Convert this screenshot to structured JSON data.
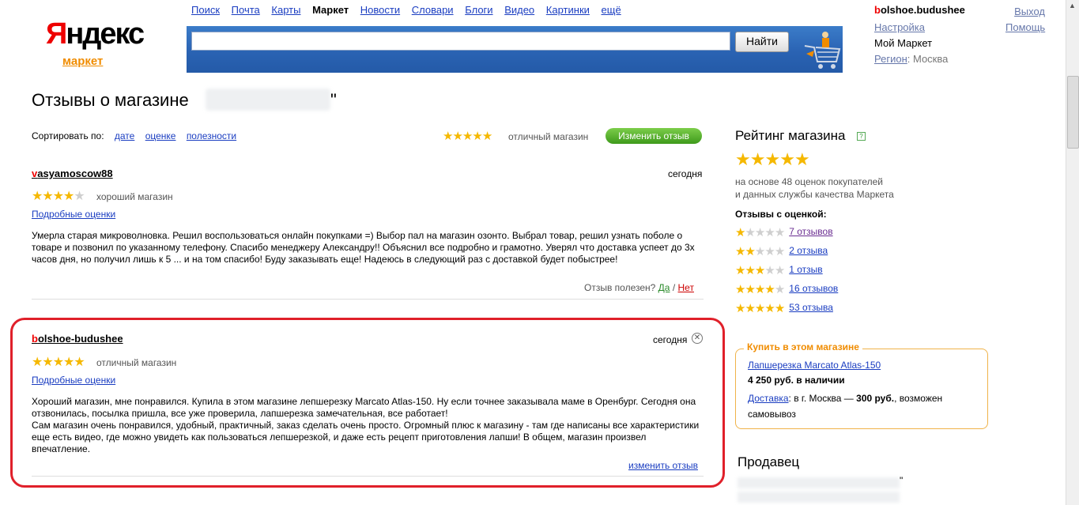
{
  "logo": {
    "first_letter": "Я",
    "rest": "ндекс",
    "sub": "маркет"
  },
  "nav": [
    "Поиск",
    "Почта",
    "Карты",
    "Маркет",
    "Новости",
    "Словари",
    "Блоги",
    "Видео",
    "Картинки",
    "ещё"
  ],
  "search": {
    "value": "",
    "button": "Найти"
  },
  "user": {
    "name_first": "b",
    "name_rest": "olshoe.budushee",
    "settings": "Настройка",
    "my_market": "Мой Маркет",
    "region_label": "Регион",
    "region_value": ": Москва",
    "logout": "Выход",
    "help": "Помощь"
  },
  "page": {
    "title": "Отзывы о магазине",
    "title_end": "\""
  },
  "sort": {
    "label": "Сортировать по:",
    "options": [
      "дате",
      "оценке",
      "полезности"
    ]
  },
  "my_rating": {
    "stars": 5,
    "label": "отличный магазин",
    "change_button": "Изменить отзыв"
  },
  "reviews": [
    {
      "user_first": "v",
      "user_rest": "asyamoscow88",
      "date": "сегодня",
      "stars": 4,
      "label": "хороший магазин",
      "details": "Подробные оценки",
      "text": "Умерла старая микроволновка. Решил воспользоваться онлайн покупками =) Выбор пал на магазин озонто. Выбрал товар, решил узнать поболе о товаре и позвонил по указанному телефону. Спасибо менеджеру Александру!! Объяснил все подробно и грамотно. Уверял что доставка успеет до 3х часов дня, но получил лишь к 5 ... и на том спасибо! Буду заказывать еще! Надеюсь в следующий раз с доставкой будет побыстрее!",
      "useful_q": "Отзыв полезен?",
      "yes": "Да",
      "sep": "/",
      "no": "Нет"
    },
    {
      "user_first": "b",
      "user_rest": "olshoe-budushee",
      "date": "сегодня",
      "stars": 5,
      "label": "отличный магазин",
      "details": "Подробные оценки",
      "text": "Хороший магазин, мне понравился. Купила в этом магазине лепшерезку Marcato Atlas-150. Ну если точнее заказывала маме в Оренбург. Сегодня она отзвонилась, посылка пришла, все уже проверила, лапшерезка замечательная, все работает!\nСам магазин очень понравился, удобный, практичный, заказ сделать очень просто. Огромный плюс к магазину - там где написаны все характеристики еще есть видео, где можно увидеть как пользоваться лепшерезкой, и даже есть рецепт приготовления лапши! В общем, магазин произвел впечатление.",
      "edit": "изменить отзыв"
    }
  ],
  "sidebar": {
    "title": "Рейтинг магазина",
    "help": "?",
    "stars": 5,
    "basis_line1": "на основе 48 оценок покупателей",
    "basis_line2": "и данных службы качества Маркета",
    "sub": "Отзывы с оценкой:",
    "distribution": [
      {
        "stars": 1,
        "label": "7 отзывов"
      },
      {
        "stars": 2,
        "label": "2 отзыва"
      },
      {
        "stars": 3,
        "label": "1 отзыв"
      },
      {
        "stars": 4,
        "label": "16 отзывов"
      },
      {
        "stars": 5,
        "label": "53 отзыва"
      }
    ],
    "buy": {
      "title": "Купить в этом магазине",
      "product": "Лапшерезка Marcato Atlas-150",
      "price": "4 250 руб. в наличии",
      "delivery_label": "Доставка",
      "delivery_text": ": в г. Москва — ",
      "delivery_price": "300 руб.",
      "delivery_tail": ", возможен самовывоз"
    },
    "seller_title": "Продавец",
    "seller_quote": "\""
  },
  "colors": {
    "star": "#f5b800",
    "link": "#1a3dc1",
    "highlight": "#e0202a",
    "button_green": "#3e9a1b"
  }
}
